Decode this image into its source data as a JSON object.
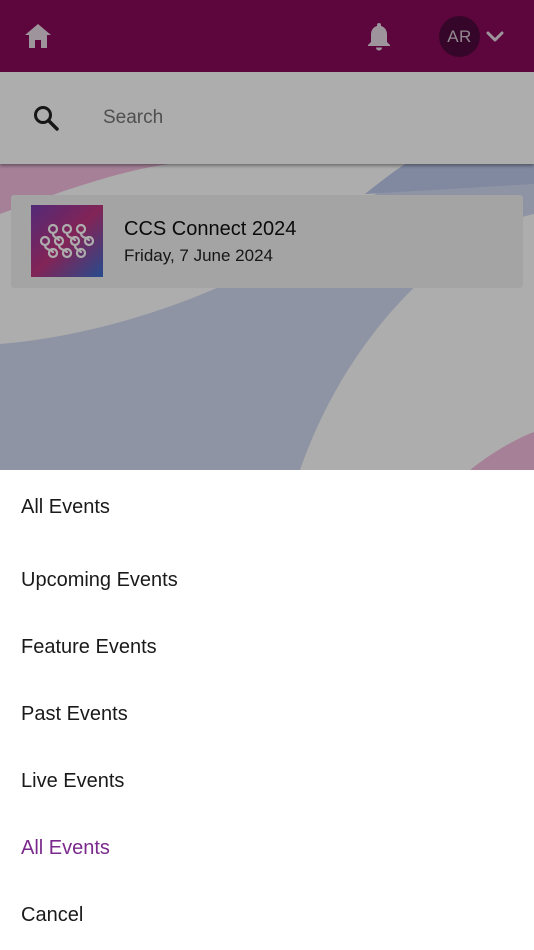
{
  "header": {
    "avatar_initials": "AR",
    "bar_color": "#8a0a5a"
  },
  "search": {
    "placeholder": "Search",
    "value": ""
  },
  "events": [
    {
      "title": "CCS Connect 2024",
      "date": "Friday, 7 June 2024"
    }
  ],
  "filter_sheet": {
    "title": "All Events",
    "options": [
      {
        "label": "Upcoming Events",
        "selected": false
      },
      {
        "label": "Feature Events",
        "selected": false
      },
      {
        "label": "Past Events",
        "selected": false
      },
      {
        "label": "Live Events",
        "selected": false
      },
      {
        "label": "All Events",
        "selected": true
      },
      {
        "label": "Cancel",
        "selected": false
      }
    ],
    "selected_color": "#7a2a8c"
  },
  "icons": [
    "home-icon",
    "bell-icon",
    "chevron-down-icon",
    "search-icon"
  ]
}
